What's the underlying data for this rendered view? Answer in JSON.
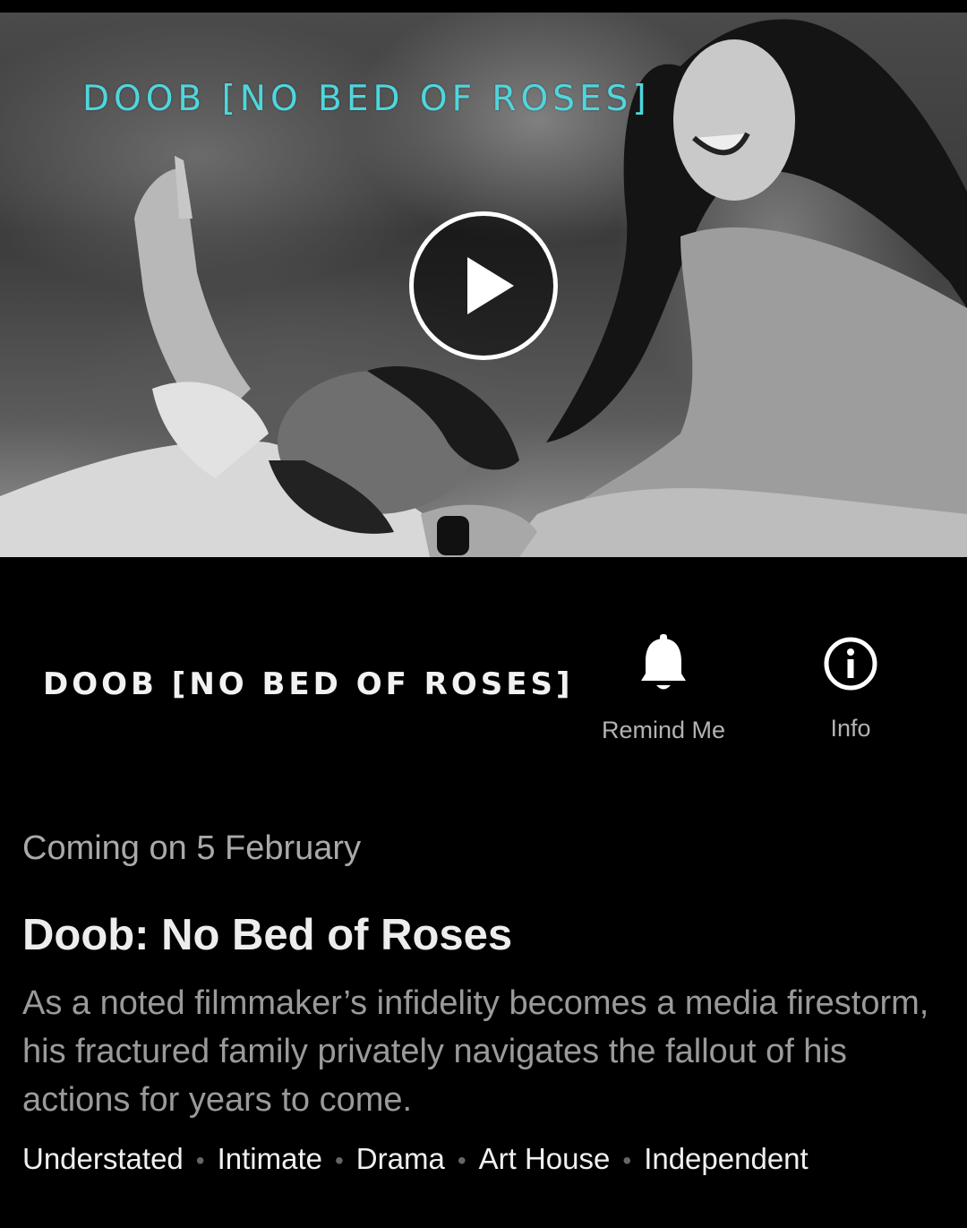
{
  "hero": {
    "overlay_title": "DOOB [NO BED OF ROSES]"
  },
  "header": {
    "logo_title": "DOOB [NO BED OF ROSES]"
  },
  "actions": {
    "remind_label": "Remind Me",
    "remind_icon": "bell-icon",
    "info_label": "Info",
    "info_icon": "info-icon"
  },
  "details": {
    "coming": "Coming on 5 February",
    "title": "Doob: No Bed of Roses",
    "synopsis": "As a noted filmmaker’s infidelity becomes a media firestorm, his fractured family privately navigates the fallout of his actions for years to come.",
    "tags": [
      "Understated",
      "Intimate",
      "Drama",
      "Art House",
      "Independent"
    ]
  },
  "colors": {
    "background": "#000000",
    "hero_title": "#4fd6dd",
    "secondary_text": "#a9a9a9"
  }
}
